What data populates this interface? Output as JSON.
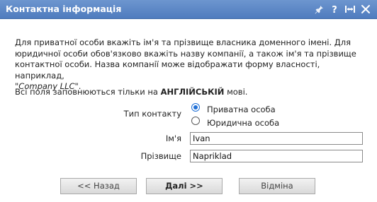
{
  "window": {
    "title": "Контактна інформація",
    "icons": [
      "pin-icon",
      "help-icon",
      "resize-icon",
      "close-icon"
    ]
  },
  "description": {
    "line1": "Для приватної особи вкажіть ім'я та прізвище власника доменного імені. Для",
    "line2": "юридичної особи обов'язково вкажіть назву компанії, а також ім'я та прізвище",
    "line3": "контактної особи. Назва компанії може відображати форму власності, наприклад,",
    "quote_open": "\"",
    "example": "Company LLC",
    "quote_close": "\"."
  },
  "language_note": {
    "prefix": "Всі поля заповнюються тільки на ",
    "language": "АНГЛІЙСЬКІЙ",
    "suffix": " мові."
  },
  "form": {
    "contact_type_label": "Тип контакту",
    "options": [
      {
        "label": "Приватна особа",
        "checked": true
      },
      {
        "label": "Юридична особа",
        "checked": false
      }
    ],
    "first_name_label": "Ім'я",
    "first_name_value": "Ivan",
    "last_name_label": "Прізвище",
    "last_name_value": "Napriklad"
  },
  "buttons": {
    "back": "<< Назад",
    "next": "Далі >>",
    "cancel": "Відміна"
  },
  "colors": {
    "titlebar": "#5a86c6",
    "accent": "#1f6fd6"
  }
}
